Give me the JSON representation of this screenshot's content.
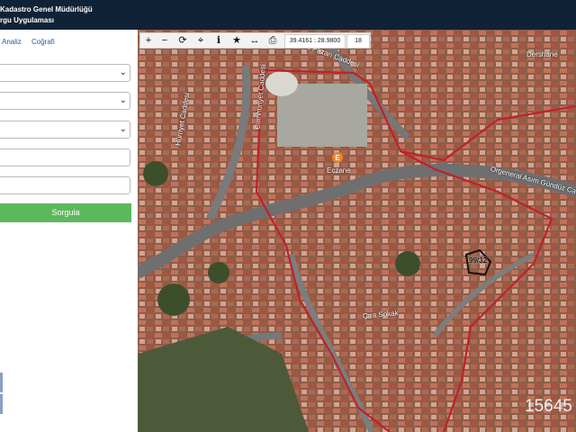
{
  "header": {
    "title": "Kadastro Genel Müdürlüğü",
    "subtitle": "rgu Uygulaması"
  },
  "sidebar": {
    "tabs": [
      "Analiz",
      "Coğrafi"
    ],
    "query_button": "Sorgula"
  },
  "toolbar": {
    "coordinates": "39.4161 : 28.9800",
    "zoom_level": "18"
  },
  "map": {
    "street_labels": [
      "Ekmez Pazarı Caddesi",
      "Orgeneral Asım Gündüz Caddesi",
      "Hürriyet Caddesi",
      "Cumhuriyet Caddesi",
      "Çıra Sokak",
      "Dershane"
    ],
    "poi_label": "Eczane",
    "poi_marker": "E",
    "parcel_label": "99/32",
    "scale_text": "15645"
  },
  "colors": {
    "header_bg": "#102235",
    "button_green": "#5cb85c",
    "boundary_red": "#c0202b",
    "tab_blue": "#1f5d96"
  }
}
